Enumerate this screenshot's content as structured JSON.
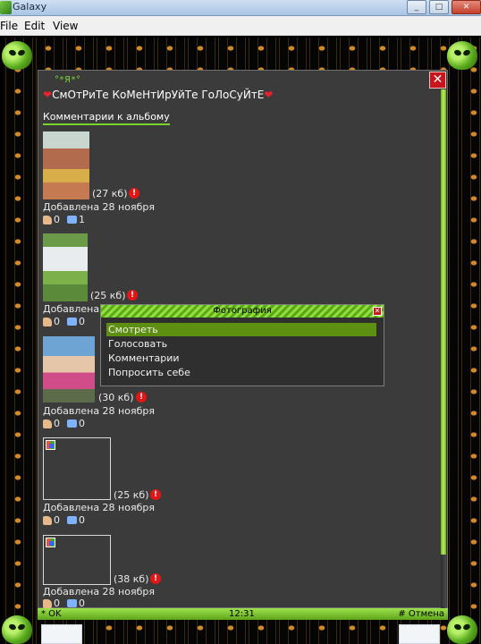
{
  "window": {
    "title": "Galaxy",
    "min": "_",
    "max": "□",
    "close": "✕"
  },
  "menu": {
    "file": "File",
    "edit": "Edit",
    "view": "View"
  },
  "profile": {
    "username": "°*Я*°",
    "status_text": "СмОтРиТе КоМеНтИрУйТе ГоЛоСуЙтЕ",
    "heart": "❤",
    "album_link": "Комментарии к альбому"
  },
  "close_label": "✕",
  "alert_glyph": "!",
  "photos": [
    {
      "size": "(27 кб)",
      "added": "Добавлена 28 ноября",
      "likes": "0",
      "comments": "1"
    },
    {
      "size": "(25 кб)",
      "added": "Добавлена",
      "likes": "0",
      "comments": "0"
    },
    {
      "size": "(30 кб)",
      "added": "Добавлена 28 ноября",
      "likes": "0",
      "comments": "0"
    },
    {
      "size": "(25 кб)",
      "added": "Добавлена 28 ноября",
      "likes": "0",
      "comments": "0"
    },
    {
      "size": "(38 кб)",
      "added": "Добавлена 28 ноября",
      "likes": "0",
      "comments": "0"
    }
  ],
  "popup": {
    "title": "Фотография",
    "items": [
      "Смотреть",
      "Голосовать",
      "Комментарии",
      "Попросить себе"
    ],
    "selected_index": 0,
    "close": "✕"
  },
  "softkeys": {
    "ok": "* OK",
    "time": "12:31",
    "cancel": "# Отмена"
  },
  "colors": {
    "accent": "#7ad12a",
    "panel": "#3b3b3b",
    "alert": "#e31515",
    "close": "#c8171c"
  },
  "icons": [
    "app-icon",
    "alien-icon",
    "close-icon",
    "like-icon",
    "comment-icon",
    "alert-icon",
    "broken-image-icon"
  ]
}
